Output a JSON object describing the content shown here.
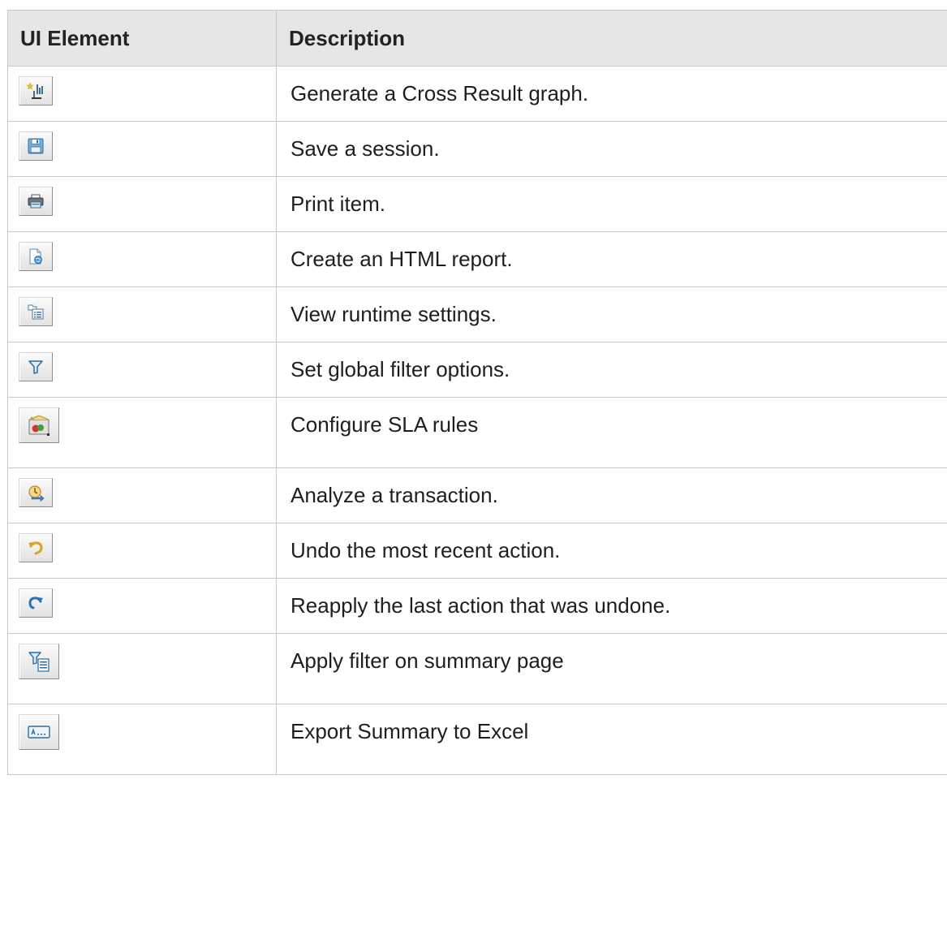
{
  "table": {
    "header": {
      "ui_element": "UI Element",
      "description": "Description"
    },
    "rows": [
      {
        "icon": "cross-result-graph-icon",
        "description": "Generate a Cross Result graph."
      },
      {
        "icon": "save-icon",
        "description": "Save a session."
      },
      {
        "icon": "print-icon",
        "description": "Print item."
      },
      {
        "icon": "html-report-icon",
        "description": "Create an HTML report."
      },
      {
        "icon": "runtime-settings-icon",
        "description": "View runtime settings."
      },
      {
        "icon": "filter-icon",
        "description": "Set global filter options."
      },
      {
        "icon": "sla-rules-icon",
        "description": "Configure SLA rules"
      },
      {
        "icon": "analyze-transaction-icon",
        "description": "Analyze a transaction."
      },
      {
        "icon": "undo-icon",
        "description": "Undo the most recent action."
      },
      {
        "icon": "redo-icon",
        "description": "Reapply the last action that was undone."
      },
      {
        "icon": "summary-filter-icon",
        "description": "Apply filter on summary page"
      },
      {
        "icon": "export-excel-icon",
        "description": "Export Summary to Excel"
      }
    ]
  }
}
